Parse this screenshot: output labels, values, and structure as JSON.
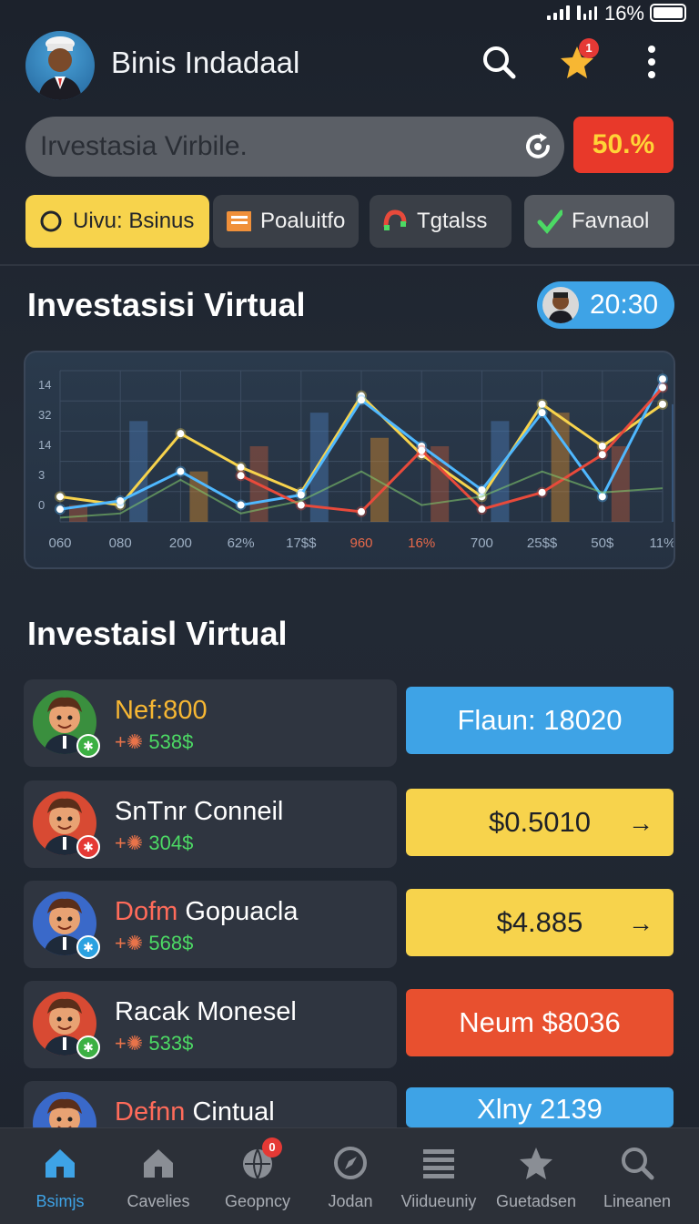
{
  "status_bar": {
    "battery": "16%"
  },
  "header": {
    "title": "Binis Indadaal",
    "notification_count": "1"
  },
  "search": {
    "value": "Irvestasia Virbile.",
    "badge": "50.%"
  },
  "filters": [
    {
      "label": "Uivu: Bsinus",
      "active": true
    },
    {
      "label": "Poaluitfo",
      "active": false
    },
    {
      "label": "Tgtalss",
      "active": false
    },
    {
      "label": "Favnaol",
      "active": false
    }
  ],
  "chart_section": {
    "title": "Investasisi Virtual",
    "time": "20:30"
  },
  "chart_data": {
    "type": "line",
    "y_ticks": [
      "14",
      "32",
      "14",
      "3",
      "0"
    ],
    "x_ticks": [
      "060",
      "080",
      "200",
      "62%",
      "17$$",
      "960",
      "16%",
      "700",
      "25$$",
      "50$",
      "11%"
    ],
    "grid": true,
    "series": [
      {
        "color": "#f7d34c",
        "values": [
          3.0,
          2.0,
          10.5,
          6.5,
          3.5,
          15.0,
          8.0,
          3.0,
          14.0,
          9.0,
          14.0
        ]
      },
      {
        "color": "#4fb8ff",
        "values": [
          1.5,
          2.5,
          6.0,
          2.0,
          3.2,
          14.5,
          9.0,
          3.8,
          13.0,
          3.0,
          17.0
        ]
      },
      {
        "color": "#e84a3b",
        "values": [
          null,
          null,
          null,
          5.5,
          2.0,
          1.2,
          8.5,
          1.5,
          3.5,
          8.0,
          16.0
        ]
      },
      {
        "color": "#7fc46b",
        "values": [
          0.5,
          1.0,
          5.0,
          1.0,
          2.5,
          6.0,
          2.0,
          3.0,
          6.0,
          3.5,
          4.0
        ]
      }
    ],
    "bars": [
      2,
      12,
      6,
      9,
      13,
      10,
      9,
      12,
      13,
      9,
      14
    ]
  },
  "list_section": {
    "title": "Investaisl Virtual"
  },
  "list": [
    {
      "name": "Nef:800",
      "name_color": "#f7b733",
      "amount": "538$",
      "action": "Flaun: 18020",
      "action_style": "blue",
      "arrow": "",
      "avatar_bg": "#3a8f3e"
    },
    {
      "name": "SnTnr Conneil",
      "name_color": "#ffffff",
      "amount": "304$",
      "action": "$0.5010",
      "action_style": "yellow",
      "arrow": "→",
      "avatar_bg": "#d84a33"
    },
    {
      "name": "Dofm Gopuacla",
      "name_color": "#ff6b5a",
      "name_prefix": "Dofm",
      "name_rest": " Gopuacla",
      "amount": "568$",
      "action": "$4.885",
      "action_style": "yellow",
      "arrow": "→",
      "avatar_bg": "#3a69c9"
    },
    {
      "name": "Racak Monesel",
      "name_color": "#ffffff",
      "amount": "533$",
      "action": "Neum $8036",
      "action_style": "red",
      "arrow": "",
      "avatar_bg": "#d84a33"
    },
    {
      "name": "Defnn Cintual",
      "name_prefix": "Defnn",
      "name_rest": " Cintual",
      "amount": "",
      "action": "Xlny 2139",
      "action_style": "blue",
      "arrow": "",
      "avatar_bg": "#3a69c9"
    }
  ],
  "nav": [
    {
      "label": "Bsimjs",
      "icon": "home-icon",
      "active": true
    },
    {
      "label": "Cavelies",
      "icon": "house-icon",
      "active": false
    },
    {
      "label": "Geopncy",
      "icon": "globe-icon",
      "active": false,
      "badge": "0"
    },
    {
      "label": "Jodan",
      "icon": "compass-icon",
      "active": false
    },
    {
      "label": "Viidueuniy",
      "icon": "list-icon",
      "active": false
    },
    {
      "label": "Guetadsen",
      "icon": "star-icon",
      "active": false
    },
    {
      "label": "Lineanen",
      "icon": "search-icon",
      "active": false
    }
  ]
}
